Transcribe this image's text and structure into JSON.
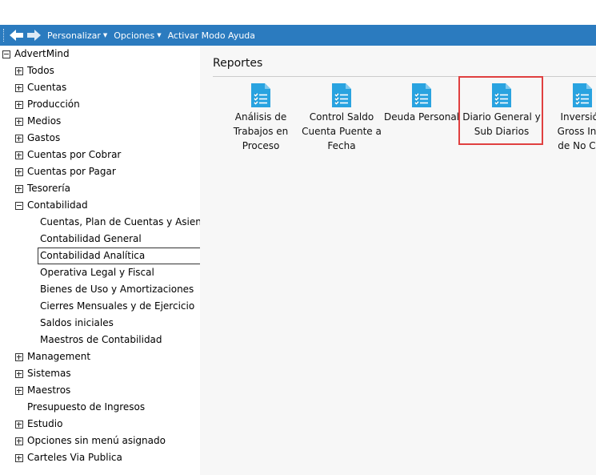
{
  "toolbar": {
    "menus": [
      "Personalizar",
      "Opciones",
      "Activar Modo Ayuda"
    ]
  },
  "tree": {
    "root": "AdvertMind",
    "items": [
      {
        "label": "Todos",
        "expander": "plus"
      },
      {
        "label": "Cuentas",
        "expander": "plus"
      },
      {
        "label": "Producción",
        "expander": "plus"
      },
      {
        "label": "Medios",
        "expander": "plus"
      },
      {
        "label": "Gastos",
        "expander": "plus"
      },
      {
        "label": "Cuentas por Cobrar",
        "expander": "plus"
      },
      {
        "label": "Cuentas por Pagar",
        "expander": "plus"
      },
      {
        "label": "Tesorería",
        "expander": "plus"
      },
      {
        "label": "Contabilidad",
        "expander": "minus"
      },
      {
        "label": "Management",
        "expander": "plus"
      },
      {
        "label": "Sistemas",
        "expander": "plus"
      },
      {
        "label": "Maestros",
        "expander": "plus"
      },
      {
        "label": "Presupuesto de Ingresos",
        "expander": "none"
      },
      {
        "label": "Estudio",
        "expander": "plus"
      },
      {
        "label": "Opciones sin menú asignado",
        "expander": "plus"
      },
      {
        "label": "Carteles Via Publica",
        "expander": "plus"
      }
    ],
    "contabilidad_children": [
      "Cuentas, Plan de Cuentas y Asientos",
      "Contabilidad General",
      "Contabilidad Analítica",
      "Operativa Legal y Fiscal",
      "Bienes de Uso y Amortizaciones",
      "Cierres Mensuales y de Ejercicio",
      "Saldos iniciales",
      "Maestros de Contabilidad"
    ],
    "selected": "Contabilidad Analítica"
  },
  "content": {
    "title": "Reportes",
    "reports": [
      {
        "lines": [
          "Análisis de",
          "Trabajos en",
          "Proceso"
        ]
      },
      {
        "lines": [
          "Control Saldo",
          "Cuenta Puente a",
          "Fecha"
        ]
      },
      {
        "lines": [
          "Deuda Personal"
        ]
      },
      {
        "lines": [
          "Diario General y",
          "Sub Diarios"
        ]
      },
      {
        "lines": [
          "Inversión",
          "Gross Inco",
          "de No Clie"
        ]
      }
    ],
    "highlighted_report": "Diario General y Sub Diarios",
    "icon_color": "#29a3e0",
    "highlight_color": "#e04040"
  },
  "colors": {
    "toolbar": "#2b7bbf"
  }
}
